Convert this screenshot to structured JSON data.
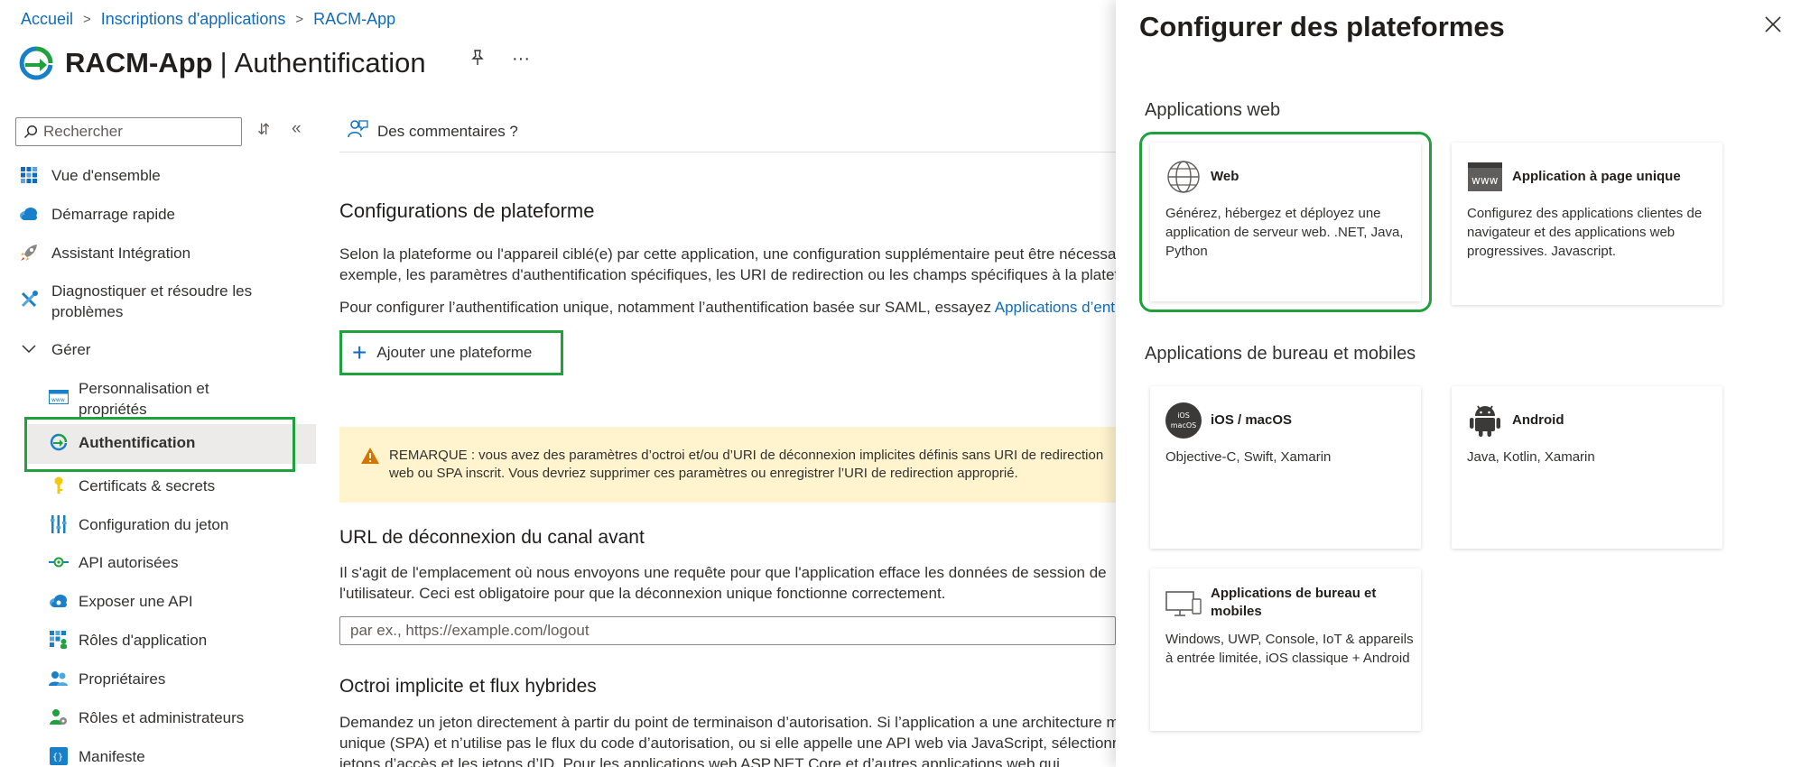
{
  "breadcrumb": {
    "home": "Accueil",
    "registrations": "Inscriptions d'applications",
    "app": "RACM-App"
  },
  "header": {
    "app_name": "RACM-App",
    "separator": "|",
    "page": "Authentification",
    "more": "···"
  },
  "sidebar": {
    "search_placeholder": "Rechercher",
    "items": [
      {
        "label": "Vue d'ensemble",
        "icon": "grid-icon"
      },
      {
        "label": "Démarrage rapide",
        "icon": "cloud-icon"
      },
      {
        "label": "Assistant Intégration",
        "icon": "rocket-icon"
      },
      {
        "label": "Diagnostiquer et résoudre les problèmes",
        "icon": "wrench-icon"
      },
      {
        "label": "Gérer",
        "icon": "chevron-down-icon"
      },
      {
        "label": "Personnalisation et propriétés",
        "icon": "branding-icon"
      },
      {
        "label": "Authentification",
        "icon": "authentication-icon"
      },
      {
        "label": "Certificats & secrets",
        "icon": "key-icon"
      },
      {
        "label": "Configuration du jeton",
        "icon": "token-bars-icon"
      },
      {
        "label": "API autorisées",
        "icon": "api-permission-icon"
      },
      {
        "label": "Exposer une API",
        "icon": "cloud-expose-icon"
      },
      {
        "label": "Rôles d'application",
        "icon": "app-roles-icon"
      },
      {
        "label": "Propriétaires",
        "icon": "owners-icon"
      },
      {
        "label": "Rôles et administrateurs",
        "icon": "admin-roles-icon"
      },
      {
        "label": "Manifeste",
        "icon": "manifest-icon"
      }
    ]
  },
  "main": {
    "feedback": "Des commentaires ?",
    "platform_title": "Configurations de plateforme",
    "platform_p1": "Selon la plateforme ou l'appareil ciblé(e) par cette application, une configuration supplémentaire peut être nécessaire, par",
    "platform_p2": "exemple, les paramètres d'authentification spécifiques, les URI de redirection ou les champs spécifiques à la plateforme.",
    "sso_text": "Pour configurer l’authentification unique, notamment l’authentification basée sur SAML, essayez ",
    "sso_link": "Applications d’entreprise",
    "add_platform": "Ajouter une plateforme",
    "warning_l1": "REMARQUE : vous avez des paramètres d’octroi et/ou d’URI de déconnexion implicites définis sans URI de redirection",
    "warning_l2": "web ou SPA inscrit. Vous devriez supprimer ces paramètres ou enregistrer l’URI de redirection approprié.",
    "logout_title": "URL de déconnexion du canal avant",
    "logout_p1": "Il s'agit de l'emplacement où nous envoyons une requête pour que l'application efface les données de session de",
    "logout_p2": "l'utilisateur. Ceci est obligatoire pour que la déconnexion unique fonctionne correctement.",
    "logout_placeholder": "par ex., https://example.com/logout",
    "implicit_title": "Octroi implicite et flux hybrides",
    "implicit_p1": "Demandez un jeton directement à partir du point de terminaison d’autorisation. Si l’application a une architecture monopage",
    "implicit_p2": "unique (SPA) et n’utilise pas le flux du code d’autorisation, ou si elle appelle une API web via JavaScript, sélectionnez les",
    "implicit_p3": "jetons d’accès et les jetons d’ID. Pour les applications web ASP.NET Core et d’autres applications web qui"
  },
  "panel": {
    "title": "Configurer des plateformes",
    "web_section": "Applications web",
    "desktop_section": "Applications de bureau et mobiles",
    "cards": {
      "web": {
        "name": "Web",
        "desc": "Générez, hébergez et déployez une application de serveur web. .NET, Java, Python",
        "icon": "globe-icon"
      },
      "spa": {
        "name": "Application à page unique",
        "desc": "Configurez des applications clientes de navigateur et des applications web progressives. Javascript.",
        "icon": "www-icon"
      },
      "ios": {
        "name": "iOS / macOS",
        "desc": "Objective-C, Swift, Xamarin",
        "icon": "ios-macos-icon",
        "badge_l1": "iOS",
        "badge_l2": "macOS"
      },
      "android": {
        "name": "Android",
        "desc": "Java, Kotlin, Xamarin",
        "icon": "android-icon"
      },
      "desktop": {
        "name": "Applications de bureau et mobiles",
        "desc": "Windows, UWP, Console, IoT & appareils à entrée limitée, iOS classique + Android",
        "icon": "desktop-icon"
      }
    }
  },
  "colors": {
    "highlight": "#1fa13d",
    "link": "#0f6cbd",
    "warning_bg": "#fff4ce",
    "warning_icon": "#d47500"
  }
}
